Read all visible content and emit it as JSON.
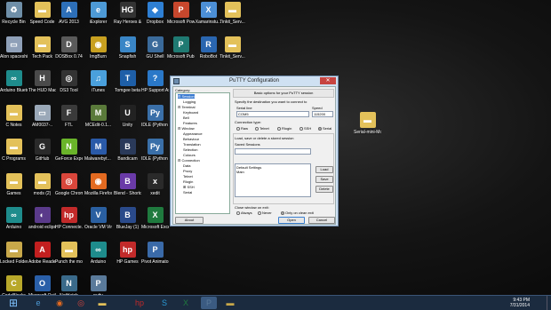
{
  "desktop": {
    "icons": [
      {
        "label": "Recycle Bin",
        "icon": "recycle-bin-icon",
        "glyph": "♻",
        "color": "#6f8fa8"
      },
      {
        "label": "Speed Code",
        "icon": "folder-icon",
        "glyph": "▬",
        "color": "#e3c15a"
      },
      {
        "label": "AVG 2013",
        "icon": "avg-icon",
        "glyph": "A",
        "color": "#2d6fb8"
      },
      {
        "label": "iExplorer",
        "icon": "iexplorer-icon",
        "glyph": "e",
        "color": "#4d9ad6"
      },
      {
        "label": "Ray Heroes & Generals",
        "icon": "heroes-icon",
        "glyph": "HG",
        "color": "#333333"
      },
      {
        "label": "Dropbox",
        "icon": "dropbox-icon",
        "glyph": "◆",
        "color": "#2e7fd3"
      },
      {
        "label": "Microsoft PowerPoi...",
        "icon": "powerpoint-icon",
        "glyph": "P",
        "color": "#c7472d"
      },
      {
        "label": "Xamarinstu...",
        "icon": "xamarin-icon",
        "glyph": "X",
        "color": "#4c8fd6"
      },
      {
        "label": "Tinkit_Serv...",
        "icon": "folder-icon",
        "glyph": "▬",
        "color": "#e3c15a"
      },
      {
        "label": "Alon spaceship...",
        "icon": "file-icon",
        "glyph": "▭",
        "color": "#8fa0b8"
      },
      {
        "label": "Tech Pack",
        "icon": "folder-icon",
        "glyph": "▬",
        "color": "#e3c15a"
      },
      {
        "label": "DOSBox 0.74",
        "icon": "dosbox-icon",
        "glyph": "D",
        "color": "#5a5a5a"
      },
      {
        "label": "ImgBurn",
        "icon": "imgburn-icon",
        "glyph": "◉",
        "color": "#c8a020"
      },
      {
        "label": "Snapfish",
        "icon": "snapfish-icon",
        "glyph": "S",
        "color": "#3a86c6"
      },
      {
        "label": "GU Shell",
        "icon": "gushell-icon",
        "glyph": "G",
        "color": "#3a6a9a"
      },
      {
        "label": "Microsoft Publish...",
        "icon": "publisher-icon",
        "glyph": "P",
        "color": "#1f7a72"
      },
      {
        "label": "RoboBot",
        "icon": "robobot-icon",
        "glyph": "R",
        "color": "#2a66b0"
      },
      {
        "label": "Tinkit_Serv...",
        "icon": "folder-icon",
        "glyph": "▬",
        "color": "#e3c15a"
      },
      {
        "label": "Arduino Bluetooth...",
        "icon": "arduino-icon",
        "glyph": "∞",
        "color": "#1e8c8c"
      },
      {
        "label": "The HUD Mackintosh...",
        "icon": "hud-icon",
        "glyph": "H",
        "color": "#4a4a4a"
      },
      {
        "label": "DS3 Tool",
        "icon": "ds3-icon",
        "glyph": "◎",
        "color": "#333333"
      },
      {
        "label": "iTunes",
        "icon": "itunes-icon",
        "glyph": "♫",
        "color": "#4aa0dc"
      },
      {
        "label": "Tomgee beta",
        "icon": "tomgee-icon",
        "glyph": "T",
        "color": "#1e5fa8"
      },
      {
        "label": "HP Support Assistant",
        "icon": "hp-support-icon",
        "glyph": "?",
        "color": "#2a78c8"
      },
      {
        "label": "C Notes",
        "icon": "folder-icon",
        "glyph": "▬",
        "color": "#e3c15a"
      },
      {
        "label": "AM0037-..",
        "icon": "file-icon",
        "glyph": "▭",
        "color": "#9aa8b8"
      },
      {
        "label": "FTL",
        "icon": "ftl-icon",
        "glyph": "F",
        "color": "#3a3a3a"
      },
      {
        "label": "MCEdit-0.1...",
        "icon": "mcedit-icon",
        "glyph": "M",
        "color": "#5a7a3a"
      },
      {
        "label": "Unity",
        "icon": "unity-icon",
        "glyph": "U",
        "color": "#222222"
      },
      {
        "label": "IDLE (Python GUI) 2.7",
        "icon": "idle-icon",
        "glyph": "Py",
        "color": "#3a6fa8"
      },
      {
        "label": "C Programs",
        "icon": "folder-icon",
        "glyph": "▬",
        "color": "#e3c15a"
      },
      {
        "label": "GitHub",
        "icon": "github-icon",
        "glyph": "G",
        "color": "#2a2a2a"
      },
      {
        "label": "GeForce Experience",
        "icon": "geforce-icon",
        "glyph": "N",
        "color": "#6ab42a"
      },
      {
        "label": "Malwarebyt... Anti-Malware",
        "icon": "malwarebytes-icon",
        "glyph": "M",
        "color": "#2a5aa8"
      },
      {
        "label": "Bandicam",
        "icon": "bandicam-icon",
        "glyph": "B",
        "color": "#2a3a5a"
      },
      {
        "label": "IDLE (Python GUI) 3.3",
        "icon": "idle-icon",
        "glyph": "Py",
        "color": "#3a6fa8"
      },
      {
        "label": "Games",
        "icon": "folder-icon",
        "glyph": "▬",
        "color": "#e3c15a"
      },
      {
        "label": "mods (2)",
        "icon": "folder-icon",
        "glyph": "▬",
        "color": "#e3c15a"
      },
      {
        "label": "Google Chrome",
        "icon": "chrome-icon",
        "glyph": "◎",
        "color": "#d9463b"
      },
      {
        "label": "Mozilla Firefox",
        "icon": "firefox-icon",
        "glyph": "◉",
        "color": "#e36a20"
      },
      {
        "label": "Blend - Shortcut",
        "icon": "blend-icon",
        "glyph": "B",
        "color": "#6a3aa8"
      },
      {
        "label": "xedit",
        "icon": "xedit-icon",
        "glyph": "x",
        "color": "#2a2a2a"
      },
      {
        "label": "Arduino",
        "icon": "arduino-icon",
        "glyph": "∞",
        "color": "#1e8c8c"
      },
      {
        "label": "android eclipse",
        "icon": "eclipse-icon",
        "glyph": "◐",
        "color": "#5a3a8a"
      },
      {
        "label": "HP Connecte...",
        "icon": "hp-icon",
        "glyph": "hp",
        "color": "#c22a2a"
      },
      {
        "label": "Oracle VM VirtualBox",
        "icon": "virtualbox-icon",
        "glyph": "V",
        "color": "#2a5fa0"
      },
      {
        "label": "BlueJay (1)",
        "icon": "bluej-icon",
        "glyph": "B",
        "color": "#2a4a8a"
      },
      {
        "label": "Microsoft Excel 2010",
        "icon": "excel-icon",
        "glyph": "X",
        "color": "#1f7a3e"
      },
      {
        "label": "Locked Folder",
        "icon": "locked-folder-icon",
        "glyph": "▬",
        "color": "#c8a84a"
      },
      {
        "label": "Adobe Reader XI",
        "icon": "adobe-reader-icon",
        "glyph": "A",
        "color": "#c21f1f"
      },
      {
        "label": "Punch the monkey",
        "icon": "folder-icon",
        "glyph": "▬",
        "color": "#e3c15a"
      },
      {
        "label": "Arduino",
        "icon": "arduino-icon",
        "glyph": "∞",
        "color": "#1e8c8c"
      },
      {
        "label": "HP Games",
        "icon": "hp-games-icon",
        "glyph": "hp",
        "color": "#c22a2a"
      },
      {
        "label": "Pivot Animator",
        "icon": "pivot-icon",
        "glyph": "P",
        "color": "#3a6aa8"
      },
      {
        "label": "CodeBlocks",
        "icon": "codeblocks-icon",
        "glyph": "C",
        "color": "#b8a82a"
      },
      {
        "label": "Microsoft Outlook 2010",
        "icon": "outlook-icon",
        "glyph": "O",
        "color": "#2a5fa8"
      },
      {
        "label": "NetHatch",
        "icon": "nethatch-icon",
        "glyph": "N",
        "color": "#3a6a8a"
      },
      {
        "label": "putty",
        "icon": "putty-icon",
        "glyph": "P",
        "color": "#5a7a9a"
      },
      {
        "label": "Serial-mini-Mostpack",
        "icon": "folder-icon",
        "glyph": "▬",
        "color": "#e3c15a"
      }
    ]
  },
  "taskbar": {
    "items": [
      {
        "icon": "ie-icon",
        "glyph": "e",
        "color": "#4d9ad6"
      },
      {
        "icon": "firefox-icon",
        "glyph": "◉",
        "color": "#e36a20"
      },
      {
        "icon": "chrome-icon",
        "glyph": "◎",
        "color": "#d9463b"
      },
      {
        "icon": "explorer-icon",
        "glyph": "▬",
        "color": "#e3c15a"
      },
      {
        "icon": "hp-icon",
        "glyph": "hp",
        "color": "#c22a2a"
      },
      {
        "icon": "skype-icon",
        "glyph": "S",
        "color": "#2a9ad6"
      },
      {
        "icon": "excel-icon",
        "glyph": "X",
        "color": "#1f7a3e"
      },
      {
        "icon": "putty-icon",
        "glyph": "P",
        "color": "#5a7a9a"
      },
      {
        "icon": "folder-icon",
        "glyph": "▬",
        "color": "#c8a84a"
      }
    ],
    "clock_time": "9:43 PM",
    "clock_date": "7/31/2014"
  },
  "window": {
    "title": "PuTTY Configuration",
    "close_glyph": "✕",
    "category_label": "Category:",
    "tree": [
      {
        "label": "⊟ Session",
        "level": 0,
        "selected": true
      },
      {
        "label": "Logging",
        "level": 2
      },
      {
        "label": "⊟ Terminal",
        "level": 0
      },
      {
        "label": "Keyboard",
        "level": 2
      },
      {
        "label": "Bell",
        "level": 2
      },
      {
        "label": "Features",
        "level": 2
      },
      {
        "label": "⊟ Window",
        "level": 0
      },
      {
        "label": "Appearance",
        "level": 2
      },
      {
        "label": "Behaviour",
        "level": 2
      },
      {
        "label": "Translation",
        "level": 2
      },
      {
        "label": "Selection",
        "level": 2
      },
      {
        "label": "Colours",
        "level": 2
      },
      {
        "label": "⊟ Connection",
        "level": 0
      },
      {
        "label": "Data",
        "level": 2
      },
      {
        "label": "Proxy",
        "level": 2
      },
      {
        "label": "Telnet",
        "level": 2
      },
      {
        "label": "Rlogin",
        "level": 2
      },
      {
        "label": "⊞ SSH",
        "level": 2
      },
      {
        "label": "Serial",
        "level": 2
      }
    ],
    "header": "Basic options for your PuTTY session",
    "dest_label": "Specify the destination you want to connect to",
    "serial_line_label": "Serial line",
    "serial_line_value": "COM5",
    "speed_label": "Speed",
    "speed_value": "115200",
    "conn_type_label": "Connection type:",
    "conn_types": [
      {
        "label": "Raw",
        "checked": false
      },
      {
        "label": "Telnet",
        "checked": false
      },
      {
        "label": "Rlogin",
        "checked": false
      },
      {
        "label": "SSH",
        "checked": false
      },
      {
        "label": "Serial",
        "checked": true
      }
    ],
    "load_save_label": "Load, save or delete a stored session",
    "saved_sessions_label": "Saved Sessions",
    "saved_sessions_value": "",
    "sessions": [
      "Default Settings",
      "Main"
    ],
    "load_button": "Load",
    "save_button": "Save",
    "delete_button": "Delete",
    "close_exit_label": "Close window on exit:",
    "close_options": [
      {
        "label": "Always",
        "checked": false
      },
      {
        "label": "Never",
        "checked": false
      },
      {
        "label": "Only on clean exit",
        "checked": true
      }
    ],
    "about_button": "About",
    "open_button": "Open",
    "cancel_button": "Cancel"
  }
}
